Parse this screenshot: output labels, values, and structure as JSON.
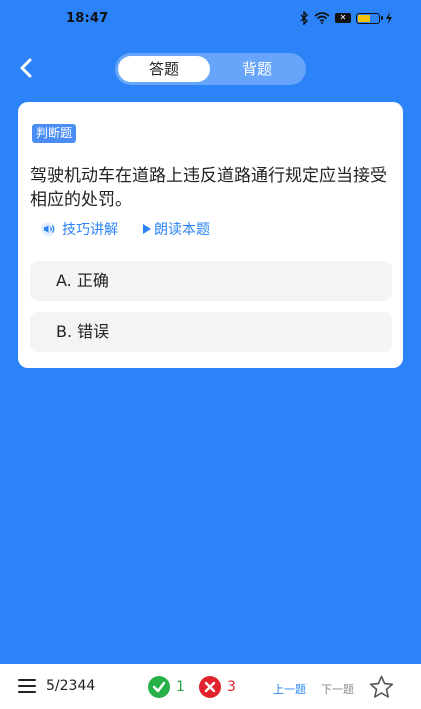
{
  "status_bar": {
    "time": "18:47",
    "sim_label": "✕"
  },
  "header": {
    "tabs": [
      {
        "label": "答题",
        "active": true
      },
      {
        "label": "背题",
        "active": false
      }
    ]
  },
  "question": {
    "type_badge": "判断题",
    "text": "驾驶机动车在道路上违反道路通行规定应当接受相应的处罚。",
    "tips_label": "技巧讲解",
    "read_label": "朗读本题",
    "options": [
      {
        "label": "A. 正确"
      },
      {
        "label": "B. 错误"
      }
    ]
  },
  "footer": {
    "progress": "5/2344",
    "correct_count": "1",
    "wrong_count": "3",
    "prev_label": "上一题",
    "next_label": "下一题"
  },
  "colors": {
    "background": "#2c83f7",
    "accent": "#2c83f7",
    "correct": "#27b04a",
    "wrong": "#e2232d"
  },
  "icons": {
    "back": "chevron-left-icon",
    "speaker": "speaker-icon",
    "play": "play-icon",
    "menu": "menu-icon",
    "star": "star-icon"
  }
}
